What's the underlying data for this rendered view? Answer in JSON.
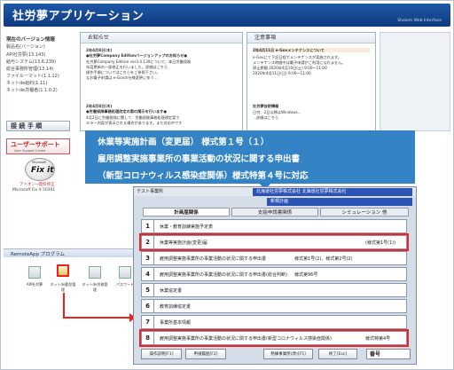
{
  "header": {
    "title": "社労夢アプリケーション",
    "subtitle": "Shalom Web Interface"
  },
  "sidebar": {
    "version_title": "現在のバージョン情報",
    "version_sub": "製品名(バージョン)",
    "versions": [
      "API社労夢(13.143)",
      "給与システム(13.6.239)",
      "総合事務所管理(13.14)",
      "ファイルーマット(1.1.12)",
      "ネットde給料(1.11)",
      "ネットde労働者(1.1.0.2)"
    ],
    "procedure_label": "接 続 手 順",
    "support_label": "ユーザーサポート",
    "support_sub": "User Support Center",
    "fixit_maker": "Microsoft",
    "fixit_label": "Fix it",
    "fixit_caption1": "アドオン→無料修正",
    "fixit_caption2": "Microsoft Fix it 50391"
  },
  "notice": {
    "title": "お知らせ",
    "date1": "2年4月8日(木)",
    "headline1": "●社労夢Company Editionバージョンアップのお知らせ●",
    "body1": [
      "社労夢Company Edition ver3.4.139について、本日労働保険",
      "年度更新の一部修正を行いました。詳細はこちら",
      "操作手順についてはこちらをご参照下さい。",
      "なお電子申請は e-Govの仕様変更に伴う..."
    ],
    "date2": "2年4月8日(木)",
    "headline2": "●労働保険事務処理改定の案の掲示を行います●",
    "body2": [
      "4月2日に労働保険に関して、労働保険事務処理改定案で",
      "エラー内容が表示される場合があります。また対応中です"
    ]
  },
  "important": {
    "title": "注意事項",
    "headline1": "2年4月11日 e-Govメンテナンスについて",
    "body1": [
      "e-Govにて下記日程でメンテナンスが実施されます。",
      "メンテナンス時間中は電子申請がご利用になれません。",
      "停止期間 2020年4月10日(土) 9:00〜11:00",
      "2020年4月11日(日) 9:00〜11:00"
    ],
    "headline2": "社労夢技術情報",
    "body2": [
      "日付、2日以降はWindows...",
      "...詳細はこちら"
    ]
  },
  "remote": {
    "title": "RemoteApp プログラム",
    "apps": [
      "API社労夢",
      "ネットde勤怠管理",
      "ネットde労務管理",
      "パスワード"
    ]
  },
  "banner": {
    "line1": "休業等実施計画（変更届） 様式第１号（１）",
    "line2": "雇用調整実施事業所の事業活動の状況に関する申出書",
    "line3": "（新型コロナウィルス感染症関係）様式特第４号に対応"
  },
  "window": {
    "company": "北海道社労夢株式会社 北海道社労夢株式会社",
    "section_label": "テスト事業所",
    "select_value": "新規計画",
    "tabs": [
      "計画届関係",
      "支給申請書関係",
      "シミュレーション 他"
    ],
    "rows": [
      {
        "n": "1",
        "text": "休業・教育訓練実施予定表",
        "c2": "",
        "c3": ""
      },
      {
        "n": "2",
        "text": "休業等実施計画(変更)届",
        "c2": "",
        "c3": "(様式第1号(1))"
      },
      {
        "n": "3",
        "text": "雇用調整実施事業所の事業活動の状況に関する申出書",
        "c2": "様式第1号(2)、様式第2号(2)",
        "c3": ""
      },
      {
        "n": "4",
        "text": "雇用調整実施事業所の事業活動の状況に関する申出書(総合判断)",
        "c2": "様式第96号",
        "c3": ""
      },
      {
        "n": "5",
        "text": "休業協定書",
        "c2": "",
        "c3": ""
      },
      {
        "n": "6",
        "text": "教育訓練協定書",
        "c2": "",
        "c3": ""
      },
      {
        "n": "7",
        "text": "事業所基本情報",
        "c2": "",
        "c3": ""
      },
      {
        "n": "8",
        "text": "雇用調整実施事業所の事業活動の状況に関する申出書(新型コロナウィルス感染症関係)",
        "c2": "",
        "c3": "様式特第4号"
      }
    ],
    "buttons": [
      "操作説明[F1]",
      "申請履歴[F2]",
      "熟練事業所(改)[F5]",
      "終了[Esc]"
    ],
    "field_label": "番号"
  }
}
